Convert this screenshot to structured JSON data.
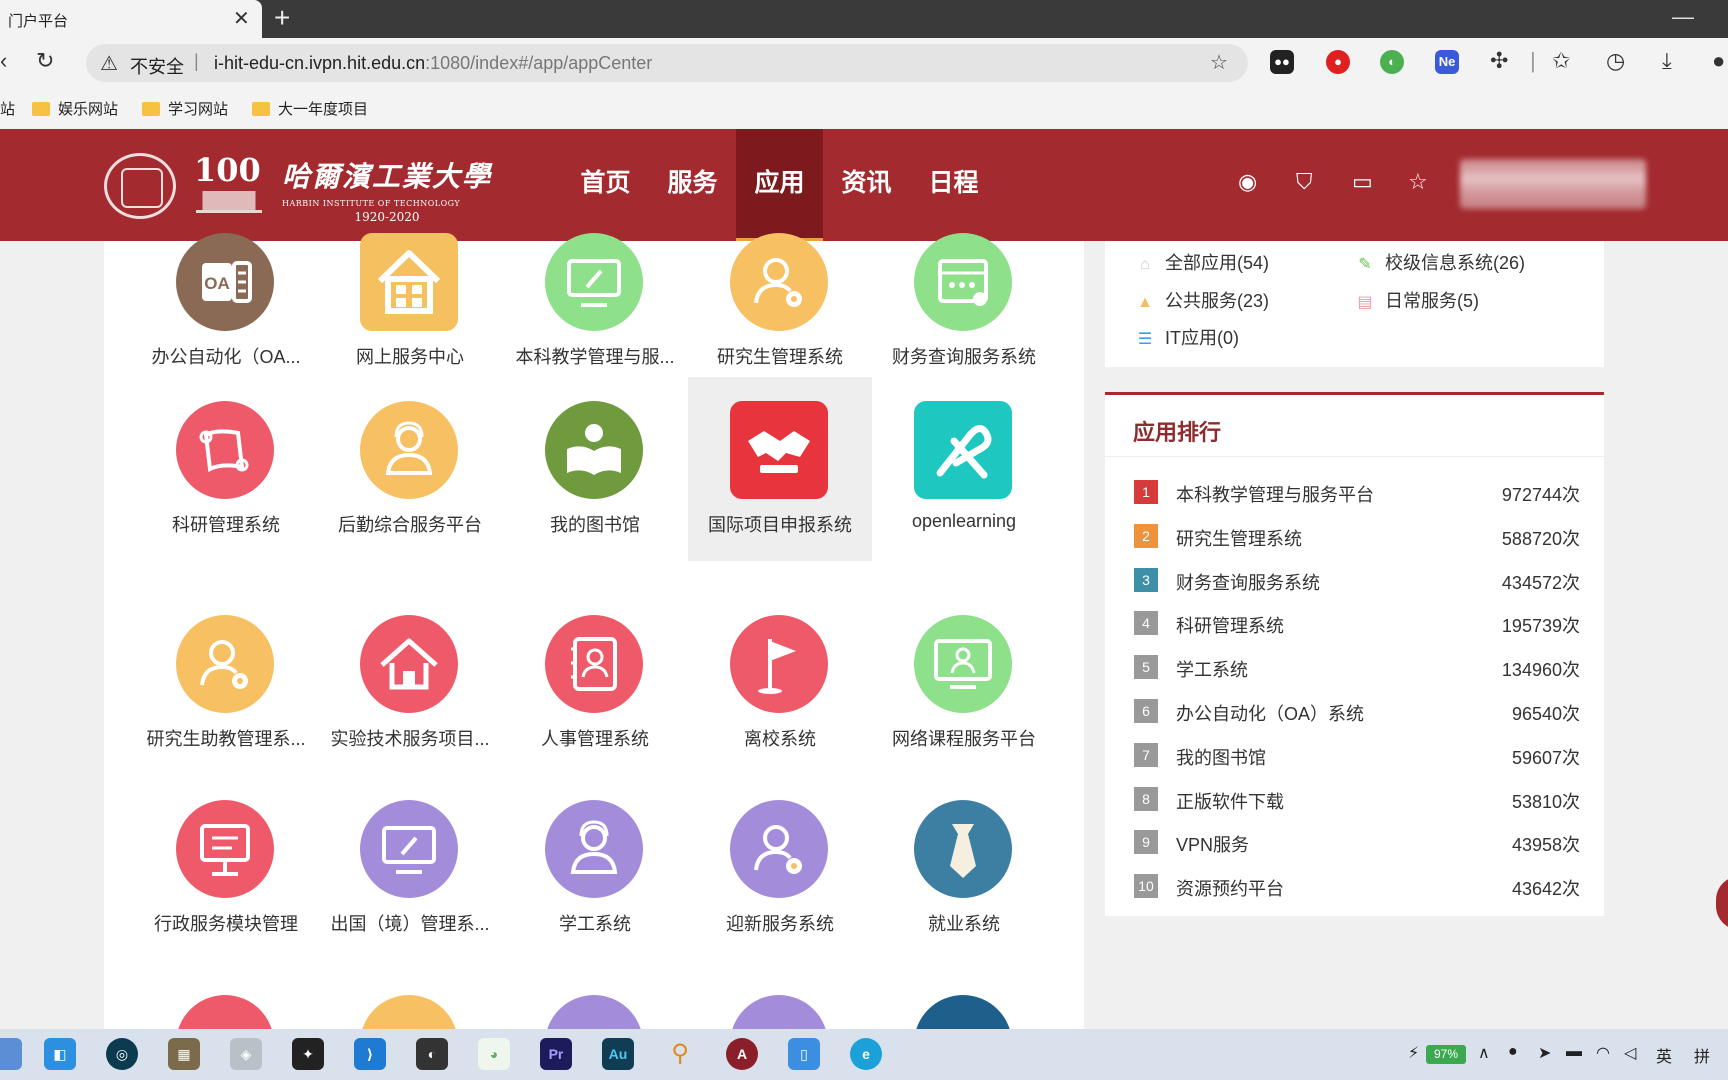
{
  "browser": {
    "tab_title": "门户平台",
    "tab_close": "✕",
    "new_tab": "+",
    "insecure_label": "不安全",
    "url_host": "i-hit-edu-cn.ivpn.hit.edu.cn",
    "url_rest": ":1080/index#/app/appCenter",
    "bookmarks": [
      "站",
      "娱乐网站",
      "学习网站",
      "大一年度项目"
    ]
  },
  "header": {
    "logo_hundred": "100",
    "logo_cn": "哈爾濱工業大學",
    "logo_en": "HARBIN INSTITUTE OF TECHNOLOGY",
    "logo_years": "1920-2020",
    "nav": [
      "首页",
      "服务",
      "应用",
      "资讯",
      "日程"
    ],
    "active_nav": "应用",
    "brand_color": "#a32a2f"
  },
  "apps": [
    {
      "label": "办公自动化（OA...",
      "icon": "oa-icon",
      "color": "#8b6a55"
    },
    {
      "label": "网上服务中心",
      "icon": "house-icon",
      "color": "#f5c060"
    },
    {
      "label": "本科教学管理与服...",
      "icon": "monitor-pen-icon",
      "color": "#8ee08a"
    },
    {
      "label": "研究生管理系统",
      "icon": "user-gear-icon",
      "color": "#f7c062"
    },
    {
      "label": "财务查询服务系统",
      "icon": "abacus-icon",
      "color": "#8ee08a"
    },
    {
      "label": "科研管理系统",
      "icon": "scroll-icon",
      "color": "#ee5a6a"
    },
    {
      "label": "后勤综合服务平台",
      "icon": "headset-user-icon",
      "color": "#f7c062"
    },
    {
      "label": "我的图书馆",
      "icon": "book-reader-icon",
      "color": "#6f9a3d"
    },
    {
      "label": "国际项目申报系统",
      "icon": "handshake-icon",
      "color": "#e8343c"
    },
    {
      "label": "openlearning",
      "icon": "openlearning-icon",
      "color": "#1ec7c0"
    },
    {
      "label": "研究生助教管理系...",
      "icon": "user-gear-icon",
      "color": "#f7c062"
    },
    {
      "label": "实验技术服务项目...",
      "icon": "house-outline-icon",
      "color": "#ee5a6a"
    },
    {
      "label": "人事管理系统",
      "icon": "contact-book-icon",
      "color": "#ee5a6a"
    },
    {
      "label": "离校系统",
      "icon": "flag-icon",
      "color": "#ee5a6a"
    },
    {
      "label": "网络课程服务平台",
      "icon": "monitor-user-icon",
      "color": "#8ee08a"
    },
    {
      "label": "行政服务模块管理",
      "icon": "kiosk-icon",
      "color": "#ee5a6a"
    },
    {
      "label": "出国（境）管理系...",
      "icon": "monitor-pen-icon",
      "color": "#a38ddb"
    },
    {
      "label": "学工系统",
      "icon": "headset-user-icon",
      "color": "#a38ddb"
    },
    {
      "label": "迎新服务系统",
      "icon": "user-gear-icon",
      "color": "#a38ddb"
    },
    {
      "label": "就业系统",
      "icon": "tie-icon",
      "color": "#3d7fa3"
    }
  ],
  "partial_row_colors": [
    "#ee5a6a",
    "#f7c062",
    "#a38ddb",
    "#a38ddb",
    "#1f5f8b"
  ],
  "categories": [
    {
      "label": "全部应用(54)",
      "icon": "home-icon",
      "color": "#bbbbbb"
    },
    {
      "label": "校级信息系统(26)",
      "icon": "pencil-icon",
      "color": "#6bbf59"
    },
    {
      "label": "公共服务(23)",
      "icon": "bell-icon",
      "color": "#f0c060"
    },
    {
      "label": "日常服务(5)",
      "icon": "doc-icon",
      "color": "#ef9a9a"
    },
    {
      "label": "IT应用(0)",
      "icon": "list-icon",
      "color": "#3aa0d8"
    }
  ],
  "ranking": {
    "title": "应用排行",
    "items": [
      {
        "rank": "1",
        "name": "本科教学管理与服务平台",
        "count": "972744次",
        "color": "#d63b3b"
      },
      {
        "rank": "2",
        "name": "研究生管理系统",
        "count": "588720次",
        "color": "#f0923a"
      },
      {
        "rank": "3",
        "name": "财务查询服务系统",
        "count": "434572次",
        "color": "#3d90a8"
      },
      {
        "rank": "4",
        "name": "科研管理系统",
        "count": "195739次",
        "color": "#999999"
      },
      {
        "rank": "5",
        "name": "学工系统",
        "count": "134960次",
        "color": "#999999"
      },
      {
        "rank": "6",
        "name": "办公自动化（OA）系统",
        "count": "96540次",
        "color": "#999999"
      },
      {
        "rank": "7",
        "name": "我的图书馆",
        "count": "59607次",
        "color": "#999999"
      },
      {
        "rank": "8",
        "name": "正版软件下载",
        "count": "53810次",
        "color": "#999999"
      },
      {
        "rank": "9",
        "name": "VPN服务",
        "count": "43958次",
        "color": "#999999"
      },
      {
        "rank": "10",
        "name": "资源预约平台",
        "count": "43642次",
        "color": "#999999"
      }
    ]
  },
  "taskbar": {
    "battery": "97%",
    "ime_lang": "英",
    "ime_mode": "拼",
    "apps": [
      "Pr",
      "Au"
    ]
  }
}
